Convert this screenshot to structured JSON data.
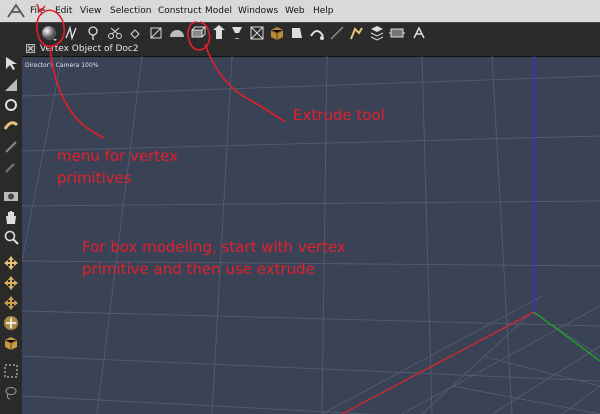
{
  "menubar": {
    "items": [
      "File",
      "Edit",
      "View",
      "Selection",
      "Construct",
      "Model",
      "Windows",
      "Web",
      "Help"
    ]
  },
  "toolbar": {
    "buttons": [
      "vertex-primitives-icon",
      "pen-icon",
      "lasso-icon",
      "scissors-icon",
      "point-icon",
      "frame-icon",
      "half-sphere-icon",
      "extrude-icon",
      "arrow-tool-icon",
      "goblet-icon",
      "cube-select-icon",
      "box-icon",
      "paint-icon",
      "rotate-icon",
      "blend-icon",
      "brush-icon",
      "walk-icon",
      "stack-icon",
      "grab-icon",
      "settings-icon"
    ]
  },
  "viewport": {
    "title": "Vertex Object of Doc2",
    "camera_label": "Director's Camera 100%"
  },
  "annotations": {
    "menu_label": "menu for vertex primitives",
    "extrude_label": "Extrude tool",
    "instruction": "For box modeling, start with vertex primitive and then use extrude"
  },
  "colors": {
    "annotation": "#e2202b",
    "viewport_bg": "#3a4256",
    "grid_line": "#5c6478",
    "axis_y": "#2f2fd6",
    "axis_z": "#1fa61f",
    "axis_x": "#d72525"
  }
}
